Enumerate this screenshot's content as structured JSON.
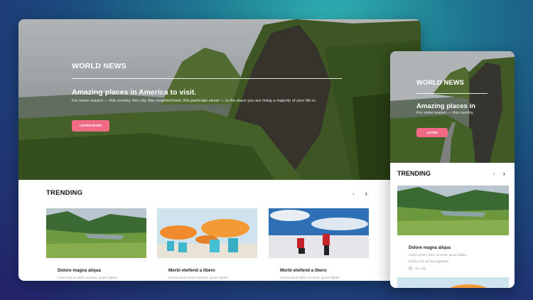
{
  "desktop": {
    "hero": {
      "tag": "WORLD NEWS",
      "title": "Amazing places in America to visit.",
      "description": "For some reason — this country, this city, this neighborhood, this particular street — is the place you are living a majority of your life in.",
      "button_label": "LEARN MORE"
    },
    "trending": {
      "heading": "TRENDING",
      "prev_icon": "chevron-left-icon",
      "next_icon": "chevron-right-icon",
      "cards": [
        {
          "title": "Dolore magna aliqua",
          "text": "Lorem ipsum dolor sit amet, ipsum labitur"
        },
        {
          "title": "Morbi eleifend a libero",
          "text": "Lorem ipsum dolor sit amet, ipsum labitur"
        },
        {
          "title": "Morbi eleifend a libero",
          "text": "Lorem ipsum dolor sit amet, ipsum labitur"
        }
      ]
    }
  },
  "mobile": {
    "hero": {
      "tag": "WORLD NEWS",
      "title": "Amazing places in",
      "description": "For some reason — this country,",
      "button_label": "LEARN"
    },
    "trending": {
      "heading": "TRENDING",
      "card": {
        "title": "Dolore magna aliqua",
        "text_line1": "Lorem ipsum dolor sit amet, ipsum labitur",
        "text_line2": "lucilius mel ad has appareat.",
        "time": "3m ago"
      }
    }
  },
  "colors": {
    "accent": "#f06a86",
    "background_top": "#2fb3b4",
    "background_bottom": "#24206a"
  }
}
